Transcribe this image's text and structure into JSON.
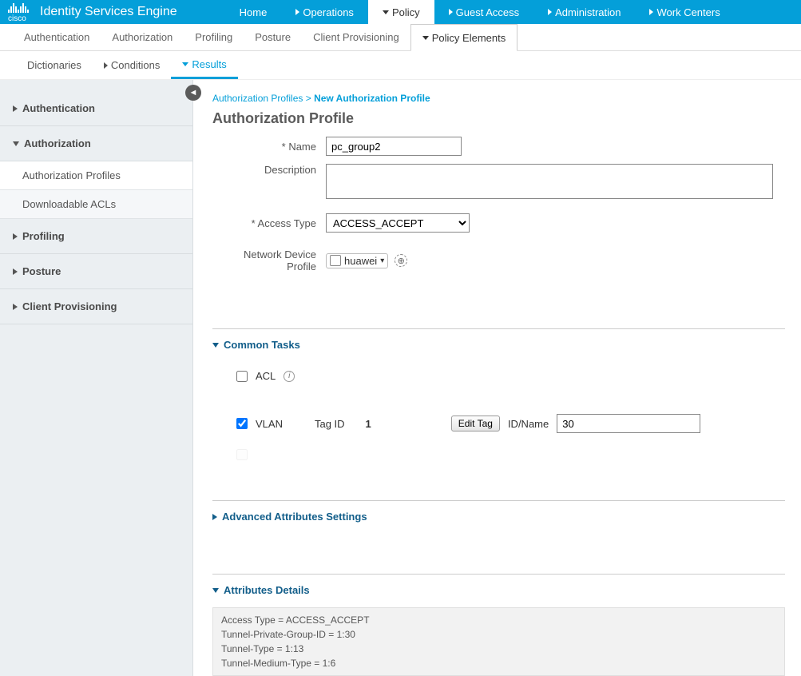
{
  "brand": {
    "logo_text": "cisco",
    "product": "Identity Services Engine"
  },
  "top_nav": {
    "home": "Home",
    "operations": "Operations",
    "policy": "Policy",
    "guest": "Guest Access",
    "admin": "Administration",
    "work": "Work Centers"
  },
  "sub_nav": {
    "authn": "Authentication",
    "authz": "Authorization",
    "profiling": "Profiling",
    "posture": "Posture",
    "client_prov": "Client Provisioning",
    "policy_elements": "Policy Elements"
  },
  "tertiary_nav": {
    "dictionaries": "Dictionaries",
    "conditions": "Conditions",
    "results": "Results"
  },
  "sidebar": {
    "authentication": "Authentication",
    "authorization": "Authorization",
    "authorization_profiles": "Authorization Profiles",
    "downloadable_acls": "Downloadable ACLs",
    "profiling": "Profiling",
    "posture": "Posture",
    "client_provisioning": "Client Provisioning"
  },
  "breadcrumb": {
    "a": "Authorization Profiles",
    "sep": ">",
    "b": "New Authorization Profile"
  },
  "page_title": "Authorization Profile",
  "form": {
    "name_label": "Name",
    "name_value": "pc_group2",
    "description_label": "Description",
    "description_value": "",
    "access_type_label": "Access Type",
    "access_type_value": "ACCESS_ACCEPT",
    "ndp_label": "Network Device Profile",
    "ndp_value": "huawei"
  },
  "common_tasks": {
    "header": "Common Tasks",
    "acl_label": "ACL",
    "vlan_label": "VLAN",
    "tag_id_label": "Tag ID",
    "tag_id_value": "1",
    "edit_tag_btn": "Edit Tag",
    "id_name_label": "ID/Name",
    "id_name_value": "30"
  },
  "adv_attr_header": "Advanced Attributes Settings",
  "attr_details": {
    "header": "Attributes Details",
    "line1": "Access Type = ACCESS_ACCEPT",
    "line2": "Tunnel-Private-Group-ID = 1:30",
    "line3": "Tunnel-Type = 1:13",
    "line4": "Tunnel-Medium-Type = 1:6"
  }
}
